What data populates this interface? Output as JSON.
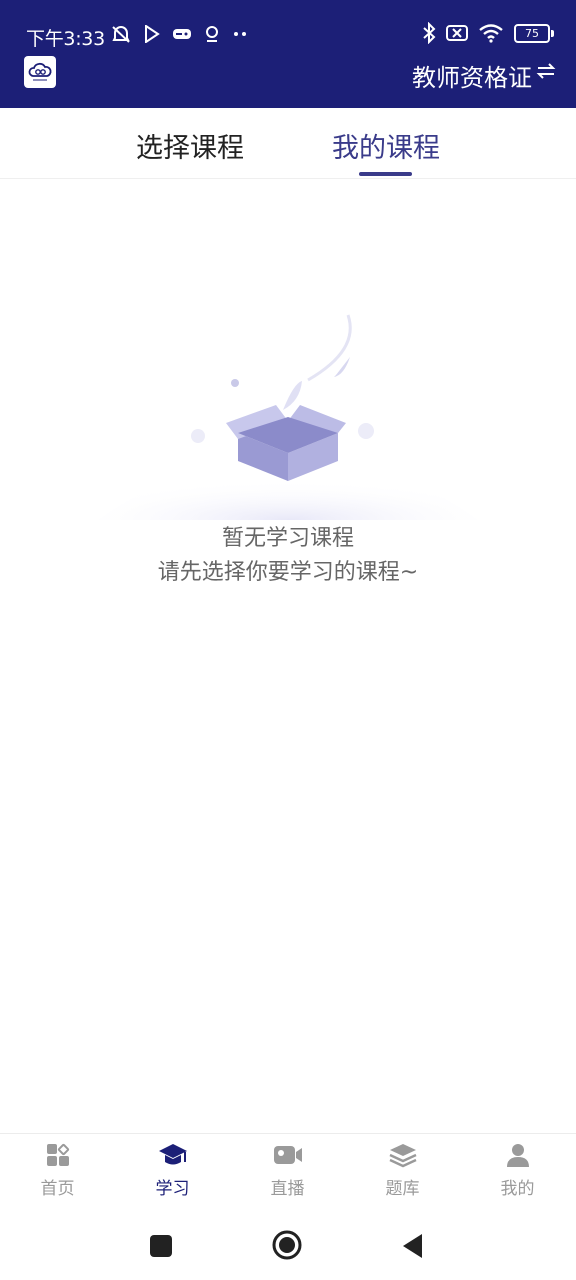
{
  "status_bar": {
    "time": "下午3:33",
    "battery": "75"
  },
  "header": {
    "title": "教师资格证"
  },
  "tabs": [
    {
      "label": "选择课程",
      "active": false
    },
    {
      "label": "我的课程",
      "active": true
    }
  ],
  "empty_state": {
    "title": "暂无学习课程",
    "subtitle": "请先选择你要学习的课程~"
  },
  "bottom_nav": [
    {
      "label": "首页",
      "icon": "home-grid-icon",
      "active": false
    },
    {
      "label": "学习",
      "icon": "graduation-cap-icon",
      "active": true
    },
    {
      "label": "直播",
      "icon": "video-camera-icon",
      "active": false
    },
    {
      "label": "题库",
      "icon": "layers-icon",
      "active": false
    },
    {
      "label": "我的",
      "icon": "user-icon",
      "active": false
    }
  ],
  "colors": {
    "brand": "#1c1f77",
    "tab_active": "#3a3b8a",
    "nav_inactive": "#9a9a9a",
    "illustration": "#9d9dd6"
  }
}
